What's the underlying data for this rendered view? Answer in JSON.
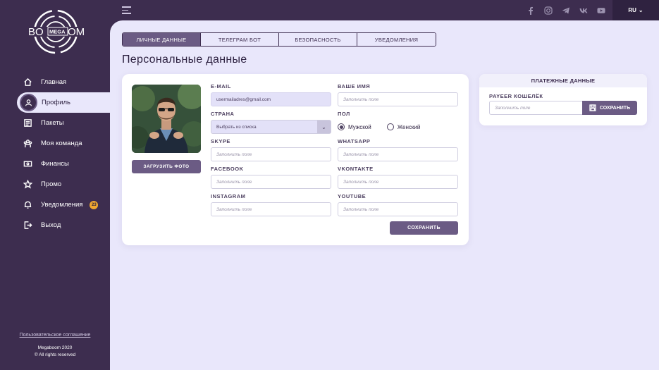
{
  "logo": {
    "left": "BO",
    "middle": "MEGA",
    "right": "OM"
  },
  "sidebar": {
    "items": [
      {
        "label": "Главная",
        "icon": "home-icon"
      },
      {
        "label": "Профиль",
        "icon": "user-icon",
        "active": true
      },
      {
        "label": "Пакеты",
        "icon": "package-icon"
      },
      {
        "label": "Моя команда",
        "icon": "team-icon"
      },
      {
        "label": "Финансы",
        "icon": "finance-icon"
      },
      {
        "label": "Промо",
        "icon": "star-icon"
      },
      {
        "label": "Уведомления",
        "icon": "bell-icon",
        "badge": "23"
      },
      {
        "label": "Выход",
        "icon": "logout-icon"
      }
    ],
    "agreement": "Пользовательское соглашение",
    "copyright_line1": "Megaboom 2020",
    "copyright_line2": "© All rights reserved"
  },
  "topbar": {
    "language": "RU",
    "socials": [
      "facebook-icon",
      "instagram-icon",
      "telegram-icon",
      "vk-icon",
      "youtube-icon"
    ]
  },
  "tabs": [
    "ЛИЧНЫЕ ДАННЫЕ",
    "ТЕЛЕГРАМ БОТ",
    "БЕЗОПАСНОСТЬ",
    "УВЕДОМЛЕНИЯ"
  ],
  "page_title": "Персональные данные",
  "profile": {
    "upload_label": "ЗАГРУЗИТЬ ФОТО",
    "email_label": "E-MAIL",
    "email_value": "usermailadres@gmail.com",
    "name_label": "ВАШЕ ИМЯ",
    "name_placeholder": "Заполнить поле",
    "country_label": "СТРАНА",
    "country_value": "Выбрать из списка",
    "gender_label": "ПОЛ",
    "gender_male": "Мужской",
    "gender_female": "Женский",
    "skype_label": "SKYPE",
    "skype_placeholder": "Заполнить поле",
    "whatsapp_label": "WHATSAPP",
    "whatsapp_placeholder": "Заполнить поле",
    "facebook_label": "FACEBOOK",
    "facebook_placeholder": "Заполнить поле",
    "vkontakte_label": "VKONTAKTE",
    "vkontakte_placeholder": "Заполнить поле",
    "instagram_label": "INSTAGRAM",
    "instagram_placeholder": "Заполнить поле",
    "youtube_label": "YOUTUBE",
    "youtube_placeholder": "Заполнить поле",
    "save_label": "СОХРАНИТЬ"
  },
  "payment": {
    "title": "ПЛАТЕЖНЫЕ ДАННЫЕ",
    "payeer_label": "PAYEER КОШЕЛЁК",
    "payeer_placeholder": "Заполнить поле",
    "save_label": "СОХРАНИТЬ"
  }
}
